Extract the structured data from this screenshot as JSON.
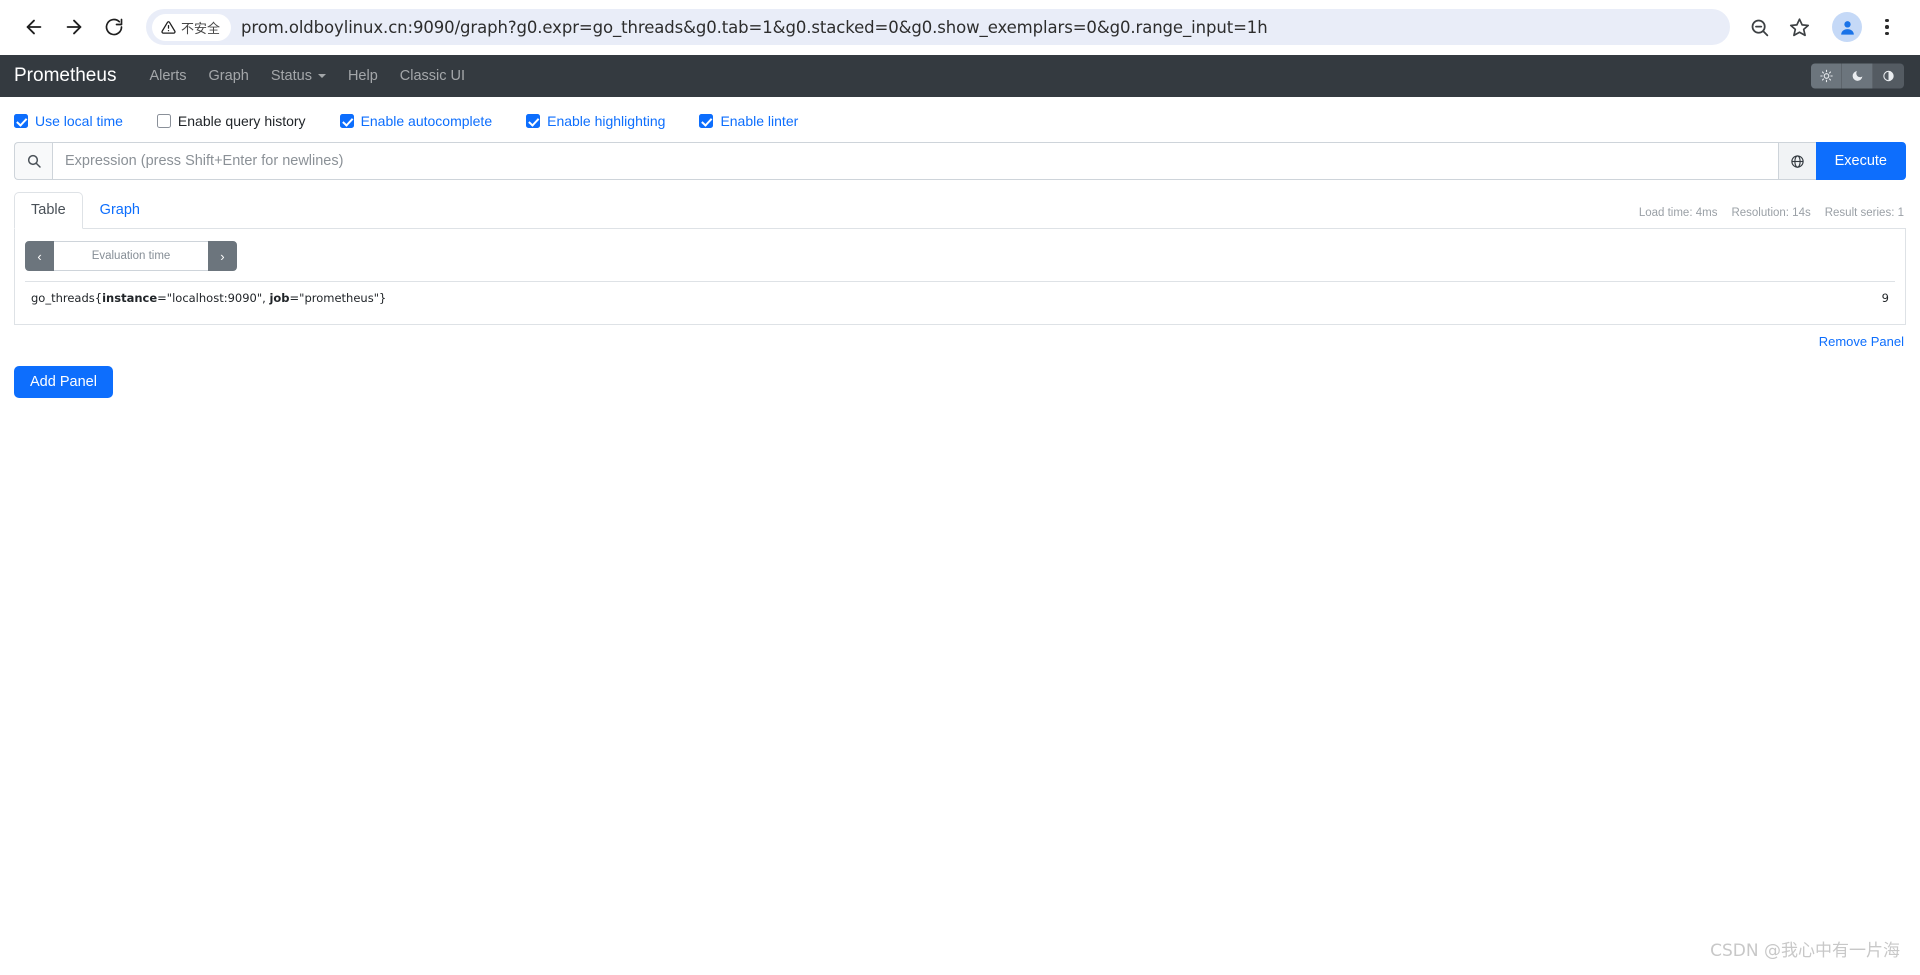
{
  "browser": {
    "back_label": "Back",
    "forward_label": "Forward",
    "reload_label": "Reload",
    "security_chip_text": "不安全",
    "url": "prom.oldboylinux.cn:9090/graph?g0.expr=go_threads&g0.tab=1&g0.stacked=0&g0.show_exemplars=0&g0.range_input=1h",
    "zoom_out_label": "Zoom out",
    "bookmark_label": "Bookmark this tab",
    "profile_label": "Profile",
    "menu_label": "Customize and control Google Chrome"
  },
  "navbar": {
    "brand": "Prometheus",
    "links": [
      {
        "label": "Alerts",
        "has_caret": false
      },
      {
        "label": "Graph",
        "has_caret": false
      },
      {
        "label": "Status",
        "has_caret": true
      },
      {
        "label": "Help",
        "has_caret": false
      },
      {
        "label": "Classic UI",
        "has_caret": false
      }
    ],
    "theme": {
      "light_label": "Light theme",
      "dark_label": "Dark theme",
      "auto_label": "Use system theme",
      "selected": "auto"
    },
    "bg_color": "#343a40"
  },
  "options": [
    {
      "label": "Use local time",
      "checked": true
    },
    {
      "label": "Enable query history",
      "checked": false
    },
    {
      "label": "Enable autocomplete",
      "checked": true
    },
    {
      "label": "Enable highlighting",
      "checked": true
    },
    {
      "label": "Enable linter",
      "checked": true
    }
  ],
  "expression": {
    "placeholder": "Expression (press Shift+Enter for newlines)",
    "value": "",
    "search_icon": "search-icon",
    "metrics_explorer_icon": "globe-icon",
    "execute_label": "Execute"
  },
  "tabs": [
    {
      "label": "Table",
      "active": true
    },
    {
      "label": "Graph",
      "active": false
    }
  ],
  "stats": {
    "load_time": "Load time: 4ms",
    "resolution": "Resolution: 14s",
    "result_series": "Result series: 1"
  },
  "evaluation": {
    "prev_label": "‹",
    "next_label": "›",
    "placeholder": "Evaluation time",
    "value": ""
  },
  "results": [
    {
      "metric_name": "go_threads",
      "labels": [
        {
          "name": "instance",
          "value": "\"localhost:9090\""
        },
        {
          "name": "job",
          "value": "\"prometheus\""
        }
      ],
      "value": "9"
    }
  ],
  "panel_actions": {
    "remove_panel_label": "Remove Panel",
    "add_panel_label": "Add Panel"
  },
  "watermark": "CSDN @我心中有一片海",
  "colors": {
    "primary": "#0d6efd",
    "navbar_dark": "#343a40",
    "secondary_gray": "#6c757d",
    "border": "#dee2e6"
  }
}
